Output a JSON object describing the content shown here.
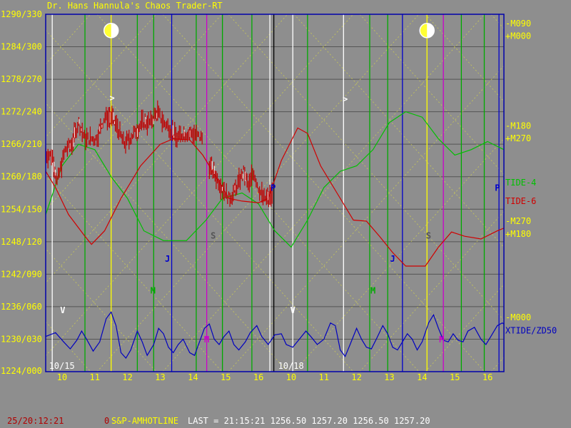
{
  "window": {
    "title": "Dr. Hans Hannula's Chaos Trader-RT"
  },
  "status_bar": {
    "time": "25/20:12:21",
    "zero": "0",
    "symbol": "S&P-AMHOTLINE",
    "last": "LAST = 21:15:21 1256.50 1257.20 1256.50 1257.20"
  },
  "colors": {
    "background": "#8e8e8e",
    "price": "#c00000",
    "tide4": "#00c000",
    "tide6": "#d00000",
    "xtide": "#0000c0",
    "frame": "#0000aa",
    "label_yellow": "#ffff00",
    "grid": "#555555"
  },
  "chart_data": {
    "type": "line",
    "title": "Dr. Hans Hannula's Chaos Trader-RT",
    "ylim": [
      1224,
      1290
    ],
    "xlim": [
      0,
      14
    ],
    "y_ticks": [
      {
        "v": 1224,
        "label": "1224/000"
      },
      {
        "v": 1230,
        "label": "1230/030"
      },
      {
        "v": 1236,
        "label": "1236/060"
      },
      {
        "v": 1242,
        "label": "1242/090"
      },
      {
        "v": 1248,
        "label": "1248/120"
      },
      {
        "v": 1254,
        "label": "1254/150"
      },
      {
        "v": 1260,
        "label": "1260/180"
      },
      {
        "v": 1266,
        "label": "1266/210"
      },
      {
        "v": 1272,
        "label": "1272/240"
      },
      {
        "v": 1278,
        "label": "1278/270"
      },
      {
        "v": 1284,
        "label": "1284/300"
      },
      {
        "v": 1290,
        "label": "1290/330"
      }
    ],
    "x_ticks": [
      {
        "x": 0.5,
        "label": "10"
      },
      {
        "x": 1.5,
        "label": "11"
      },
      {
        "x": 2.5,
        "label": "12"
      },
      {
        "x": 3.5,
        "label": "13"
      },
      {
        "x": 4.5,
        "label": "14"
      },
      {
        "x": 5.5,
        "label": "15"
      },
      {
        "x": 6.5,
        "label": "16"
      },
      {
        "x": 7.5,
        "label": "10"
      },
      {
        "x": 8.5,
        "label": "11"
      },
      {
        "x": 9.5,
        "label": "12"
      },
      {
        "x": 10.5,
        "label": "13"
      },
      {
        "x": 11.5,
        "label": "14"
      },
      {
        "x": 12.5,
        "label": "15"
      },
      {
        "x": 13.5,
        "label": "16"
      }
    ],
    "dates": [
      {
        "x": 0.1,
        "label": "10/15"
      },
      {
        "x": 7.1,
        "label": "10/18"
      }
    ],
    "right_labels": [
      {
        "v": 1288.3,
        "label": "-M090",
        "color": "#ffff00"
      },
      {
        "v": 1286.0,
        "label": "+M000",
        "color": "#ffff00"
      },
      {
        "v": 1269.4,
        "label": "-M180",
        "color": "#ffff00"
      },
      {
        "v": 1267.1,
        "label": "+M270",
        "color": "#ffff00"
      },
      {
        "v": 1258.9,
        "label": "TIDE-4",
        "color": "#00c000"
      },
      {
        "v": 1255.5,
        "label": "TIDE-6",
        "color": "#d00000"
      },
      {
        "v": 1251.8,
        "label": "-M270",
        "color": "#ffff00"
      },
      {
        "v": 1249.4,
        "label": "+M180",
        "color": "#ffff00"
      },
      {
        "v": 1234.0,
        "label": "-M000",
        "color": "#ffff00"
      },
      {
        "v": 1231.6,
        "label": "XTIDE/ZD50",
        "color": "#0000c0"
      }
    ],
    "vlines": [
      {
        "x": 0.2,
        "color": "#ffffff"
      },
      {
        "x": 1.2,
        "color": "#00aa00"
      },
      {
        "x": 2.0,
        "color": "#ffff00"
      },
      {
        "x": 2.8,
        "color": "#00aa00"
      },
      {
        "x": 3.3,
        "color": "#00aa00"
      },
      {
        "x": 3.85,
        "color": "#0000cc"
      },
      {
        "x": 4.6,
        "color": "#00aa00"
      },
      {
        "x": 4.92,
        "color": "#cc00cc"
      },
      {
        "x": 5.4,
        "color": "#00aa00"
      },
      {
        "x": 6.3,
        "color": "#00aa00"
      },
      {
        "x": 6.85,
        "color": "#ffffff"
      },
      {
        "x": 6.97,
        "color": "#000000"
      },
      {
        "x": 7.55,
        "color": "#ffffff"
      },
      {
        "x": 8.0,
        "color": "#00aa00"
      },
      {
        "x": 9.1,
        "color": "#ffffff"
      },
      {
        "x": 9.9,
        "color": "#00aa00"
      },
      {
        "x": 10.45,
        "color": "#00aa00"
      },
      {
        "x": 10.9,
        "color": "#0000cc"
      },
      {
        "x": 11.65,
        "color": "#ffff00"
      },
      {
        "x": 12.15,
        "color": "#cc00cc"
      },
      {
        "x": 12.7,
        "color": "#00aa00"
      },
      {
        "x": 13.4,
        "color": "#00aa00"
      },
      {
        "x": 13.85,
        "color": "#0000cc"
      }
    ],
    "moons": [
      {
        "x": 2.0,
        "v": 1287.0
      },
      {
        "x": 11.65,
        "v": 1287.0
      }
    ],
    "markers": [
      {
        "x": 0.52,
        "v": 1234.8,
        "text": "V",
        "color": "#ffffff"
      },
      {
        "x": 2.03,
        "v": 1274.0,
        "text": ">",
        "color": "#ffffff"
      },
      {
        "x": 3.72,
        "v": 1244.3,
        "text": "J",
        "color": "#0000cc"
      },
      {
        "x": 3.28,
        "v": 1238.4,
        "text": "M",
        "color": "#00aa00"
      },
      {
        "x": 4.92,
        "v": 1229.4,
        "text": "M",
        "color": "#cc00cc"
      },
      {
        "x": 5.12,
        "v": 1248.6,
        "text": "S",
        "color": "#555555"
      },
      {
        "x": 6.95,
        "v": 1257.4,
        "text": "P",
        "color": "#0000cc"
      },
      {
        "x": 7.55,
        "v": 1234.8,
        "text": "V",
        "color": "#ffffff"
      },
      {
        "x": 9.15,
        "v": 1273.8,
        "text": ">",
        "color": "#ffffff"
      },
      {
        "x": 10.6,
        "v": 1244.3,
        "text": "J",
        "color": "#0000cc"
      },
      {
        "x": 10.0,
        "v": 1238.4,
        "text": "M",
        "color": "#00aa00"
      },
      {
        "x": 12.1,
        "v": 1229.4,
        "text": "M",
        "color": "#cc00cc"
      },
      {
        "x": 11.7,
        "v": 1248.6,
        "text": "S",
        "color": "#555555"
      },
      {
        "x": 13.8,
        "v": 1257.4,
        "text": "P",
        "color": "#0000cc"
      }
    ],
    "series": [
      {
        "name": "TIDE-4",
        "color": "#00c000",
        "points": [
          [
            0.0,
            1253
          ],
          [
            0.5,
            1262
          ],
          [
            1.0,
            1266
          ],
          [
            1.5,
            1265
          ],
          [
            2.0,
            1260
          ],
          [
            2.5,
            1256
          ],
          [
            3.0,
            1250
          ],
          [
            3.6,
            1248.2
          ],
          [
            4.3,
            1248.2
          ],
          [
            4.9,
            1252
          ],
          [
            5.4,
            1256
          ],
          [
            6.0,
            1257
          ],
          [
            6.5,
            1255
          ],
          [
            7.0,
            1250
          ],
          [
            7.5,
            1247
          ],
          [
            8.0,
            1252
          ],
          [
            8.5,
            1258
          ],
          [
            9.0,
            1261
          ],
          [
            9.5,
            1262
          ],
          [
            10.0,
            1265
          ],
          [
            10.5,
            1270
          ],
          [
            11.0,
            1272
          ],
          [
            11.5,
            1271
          ],
          [
            12.0,
            1267
          ],
          [
            12.5,
            1264
          ],
          [
            13.0,
            1265
          ],
          [
            13.5,
            1266.5
          ],
          [
            14.0,
            1265
          ]
        ]
      },
      {
        "name": "TIDE-6",
        "color": "#d00000",
        "points": [
          [
            0.0,
            1261
          ],
          [
            0.3,
            1258
          ],
          [
            0.7,
            1253
          ],
          [
            1.2,
            1249
          ],
          [
            1.4,
            1247.5
          ],
          [
            1.8,
            1250
          ],
          [
            2.3,
            1256
          ],
          [
            2.9,
            1262
          ],
          [
            3.5,
            1266
          ],
          [
            3.9,
            1267
          ],
          [
            4.4,
            1266.8
          ],
          [
            4.8,
            1264
          ],
          [
            5.2,
            1260
          ],
          [
            5.6,
            1256
          ],
          [
            6.0,
            1255.5
          ],
          [
            6.5,
            1255.2
          ],
          [
            6.8,
            1256
          ],
          [
            7.2,
            1263
          ],
          [
            7.7,
            1269
          ],
          [
            8.0,
            1268
          ],
          [
            8.4,
            1262
          ],
          [
            8.9,
            1257
          ],
          [
            9.4,
            1252
          ],
          [
            9.8,
            1251.8
          ],
          [
            10.2,
            1249
          ],
          [
            10.6,
            1246
          ],
          [
            11.0,
            1243.5
          ],
          [
            11.6,
            1243.5
          ],
          [
            12.0,
            1247
          ],
          [
            12.4,
            1249.8
          ],
          [
            12.8,
            1249
          ],
          [
            13.3,
            1248.5
          ],
          [
            13.8,
            1250
          ],
          [
            14.0,
            1250.5
          ]
        ]
      },
      {
        "name": "XTIDE/ZD50",
        "color": "#0000c0",
        "points": [
          [
            0.0,
            1230.5
          ],
          [
            0.3,
            1231.2
          ],
          [
            0.55,
            1229.5
          ],
          [
            0.75,
            1228.2
          ],
          [
            0.95,
            1229.8
          ],
          [
            1.1,
            1231.5
          ],
          [
            1.25,
            1230.0
          ],
          [
            1.45,
            1227.8
          ],
          [
            1.65,
            1229.5
          ],
          [
            1.85,
            1233.8
          ],
          [
            2.0,
            1235.0
          ],
          [
            2.15,
            1232.5
          ],
          [
            2.3,
            1227.5
          ],
          [
            2.45,
            1226.5
          ],
          [
            2.6,
            1228.0
          ],
          [
            2.8,
            1231.5
          ],
          [
            2.95,
            1229.5
          ],
          [
            3.1,
            1227.0
          ],
          [
            3.3,
            1229.0
          ],
          [
            3.45,
            1232.0
          ],
          [
            3.6,
            1231.0
          ],
          [
            3.75,
            1228.5
          ],
          [
            3.9,
            1227.5
          ],
          [
            4.05,
            1229.0
          ],
          [
            4.2,
            1230.0
          ],
          [
            4.4,
            1227.5
          ],
          [
            4.55,
            1227.0
          ],
          [
            4.7,
            1229.5
          ],
          [
            4.85,
            1232.0
          ],
          [
            5.0,
            1232.8
          ],
          [
            5.15,
            1230.0
          ],
          [
            5.3,
            1229.0
          ],
          [
            5.45,
            1230.5
          ],
          [
            5.6,
            1231.5
          ],
          [
            5.75,
            1229.0
          ],
          [
            5.9,
            1228.0
          ],
          [
            6.1,
            1229.5
          ],
          [
            6.25,
            1231.2
          ],
          [
            6.45,
            1232.5
          ],
          [
            6.6,
            1230.5
          ],
          [
            6.8,
            1229.0
          ],
          [
            7.0,
            1230.8
          ],
          [
            7.2,
            1231.0
          ],
          [
            7.35,
            1229.0
          ],
          [
            7.55,
            1228.5
          ],
          [
            7.75,
            1230.0
          ],
          [
            7.95,
            1231.5
          ],
          [
            8.1,
            1230.5
          ],
          [
            8.3,
            1229.0
          ],
          [
            8.5,
            1230.0
          ],
          [
            8.7,
            1233.0
          ],
          [
            8.85,
            1232.5
          ],
          [
            9.0,
            1228.0
          ],
          [
            9.15,
            1226.8
          ],
          [
            9.3,
            1229.0
          ],
          [
            9.5,
            1232.0
          ],
          [
            9.65,
            1230.0
          ],
          [
            9.8,
            1228.5
          ],
          [
            9.95,
            1228.2
          ],
          [
            10.1,
            1230.0
          ],
          [
            10.3,
            1232.5
          ],
          [
            10.45,
            1231.0
          ],
          [
            10.6,
            1228.5
          ],
          [
            10.75,
            1228.0
          ],
          [
            10.9,
            1229.5
          ],
          [
            11.05,
            1231.0
          ],
          [
            11.2,
            1230.0
          ],
          [
            11.35,
            1228.0
          ],
          [
            11.5,
            1229.5
          ],
          [
            11.7,
            1233.0
          ],
          [
            11.85,
            1234.5
          ],
          [
            12.0,
            1232.0
          ],
          [
            12.15,
            1229.8
          ],
          [
            12.3,
            1229.5
          ],
          [
            12.45,
            1231.0
          ],
          [
            12.6,
            1229.8
          ],
          [
            12.75,
            1229.5
          ],
          [
            12.9,
            1231.5
          ],
          [
            13.1,
            1232.2
          ],
          [
            13.3,
            1230.0
          ],
          [
            13.45,
            1229.0
          ],
          [
            13.6,
            1230.5
          ],
          [
            13.8,
            1232.5
          ],
          [
            13.95,
            1233.0
          ],
          [
            14.0,
            1232.8
          ]
        ]
      }
    ],
    "price_segments": [
      {
        "name": "Price",
        "color": "#c00000",
        "x0": 0.0,
        "x1": 4.8,
        "anchors": [
          [
            0.0,
            1264
          ],
          [
            0.2,
            1264
          ],
          [
            0.35,
            1259
          ],
          [
            0.6,
            1265
          ],
          [
            0.8,
            1266
          ],
          [
            1.0,
            1270
          ],
          [
            1.2,
            1267
          ],
          [
            1.35,
            1267
          ],
          [
            1.55,
            1267
          ],
          [
            1.8,
            1271
          ],
          [
            2.0,
            1271
          ],
          [
            2.2,
            1269
          ],
          [
            2.4,
            1266
          ],
          [
            2.7,
            1268
          ],
          [
            2.95,
            1270
          ],
          [
            3.2,
            1270
          ],
          [
            3.4,
            1272
          ],
          [
            3.6,
            1270
          ],
          [
            3.8,
            1269
          ],
          [
            4.0,
            1267
          ],
          [
            4.2,
            1268
          ],
          [
            4.5,
            1268
          ],
          [
            4.8,
            1267
          ]
        ]
      },
      {
        "name": "Price",
        "color": "#c00000",
        "x0": 5.0,
        "x1": 6.95,
        "anchors": [
          [
            5.0,
            1262
          ],
          [
            5.2,
            1260
          ],
          [
            5.4,
            1258
          ],
          [
            5.6,
            1256
          ],
          [
            5.75,
            1257
          ],
          [
            5.9,
            1259
          ],
          [
            6.05,
            1261
          ],
          [
            6.2,
            1258
          ],
          [
            6.35,
            1261
          ],
          [
            6.5,
            1258
          ],
          [
            6.65,
            1256
          ],
          [
            6.8,
            1256
          ],
          [
            6.95,
            1256.8
          ]
        ]
      }
    ]
  }
}
